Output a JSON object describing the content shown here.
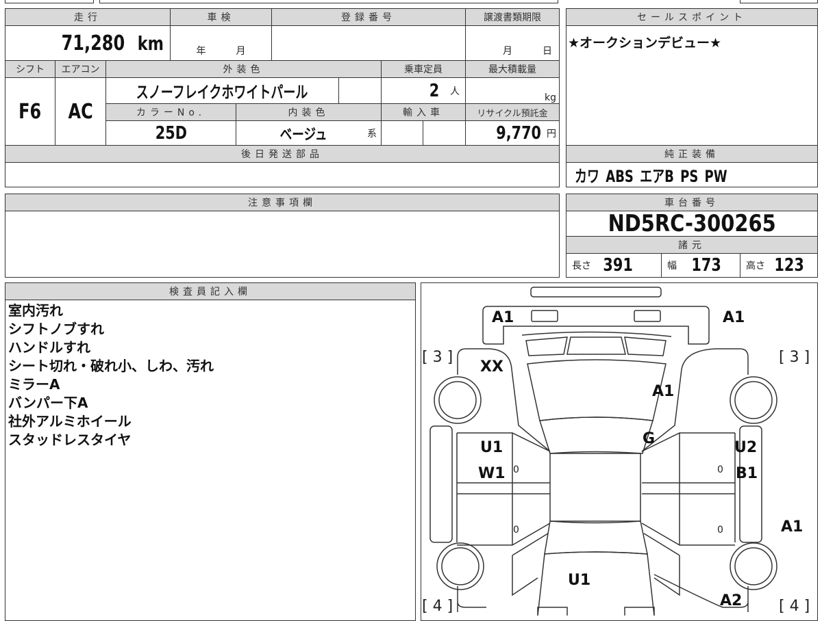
{
  "headers": {
    "mileage": "走行",
    "inspection": "車検",
    "registration": "登録番号",
    "transfer_deadline": "譲渡書類期限",
    "shift": "シフト",
    "aircon": "エアコン",
    "exterior_color": "外装色",
    "capacity": "乗車定員",
    "max_load": "最大積載量",
    "color_no": "カラーNo.",
    "interior_color": "内装色",
    "import": "輸入車",
    "recycle_fee": "リサイクル預託金",
    "parts_later": "後日発送部品",
    "sale_point": "セールスポイント",
    "equipment": "純正装備",
    "notes": "注意事項欄",
    "chassis": "車台番号",
    "specs": "諸元",
    "inspector": "検査員記入欄"
  },
  "values": {
    "mileage": "71,280",
    "mileage_unit": "km",
    "year": "年",
    "month": "月",
    "deadline_month": "月",
    "deadline_day": "日",
    "shift": "F6",
    "aircon": "AC",
    "exterior_color": "スノーフレイクホワイトパール",
    "capacity": "2",
    "capacity_unit": "人",
    "load_unit": "kg",
    "color_no": "25D",
    "interior_color": "ベージュ",
    "interior_suffix": "系",
    "recycle_fee": "9,770",
    "yen": "円"
  },
  "sale_point": "★オークションデビュー★",
  "equipment": "カワ ABS エアB PS PW",
  "chassis_number": "ND5RC-300265",
  "specs": {
    "length_label": "長さ",
    "length": "391",
    "width_label": "幅",
    "width": "173",
    "height_label": "高さ",
    "height": "123"
  },
  "inspector_notes": [
    "室内汚れ",
    "シフトノブすれ",
    "ハンドルすれ",
    "シート切れ・破れ小、しわ、汚れ",
    "ミラーA",
    "バンパー下A",
    "社外アルミホイール",
    "スタッドレスタイヤ"
  ],
  "diagram": {
    "front_left": "A1",
    "front_right": "A1",
    "tire_fl": "[ 3 ]",
    "tire_fr": "[ 3 ]",
    "fender_fl": "XX",
    "hood": "A1",
    "windshield": "G",
    "door_fl_1": "U1",
    "door_fl_2": "W1",
    "door_fr_1": "U2",
    "door_fr_2": "B1",
    "handle_fl": "0",
    "handle_fr": "0",
    "handle_rl": "0",
    "handle_rr": "0",
    "sill_r": "A1",
    "trunk": "U1",
    "quarter_rr": "A2",
    "tire_rl": "[ 4 ]",
    "tire_rr": "[ 4 ]"
  }
}
